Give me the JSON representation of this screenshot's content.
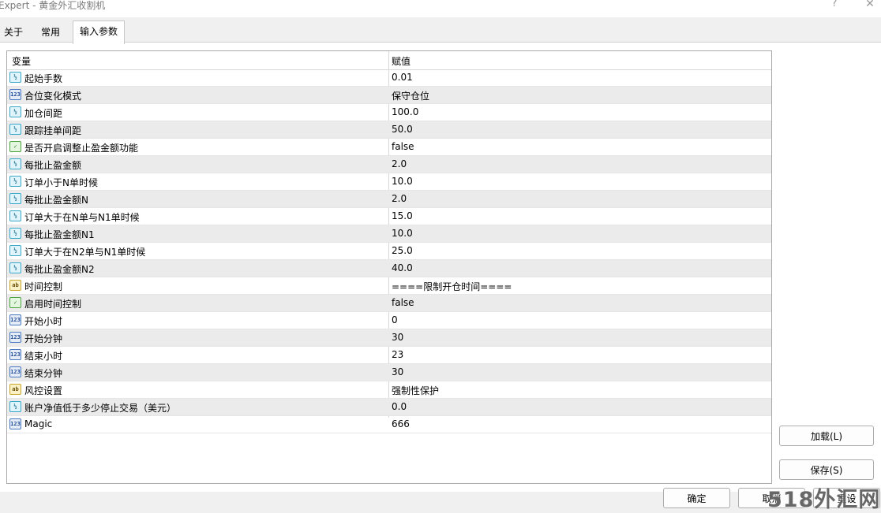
{
  "window": {
    "title": "Expert - 黄金外汇收割机",
    "help_glyph": "?",
    "close_glyph": "✕"
  },
  "tabs": [
    {
      "label": "关于"
    },
    {
      "label": "常用"
    },
    {
      "label": "输入参数",
      "selected": true
    }
  ],
  "table": {
    "headers": {
      "variable": "变量",
      "value": "赋值"
    },
    "rows": [
      {
        "icon": "double-type-icon",
        "tag": "½",
        "variable": "起始手数",
        "value": "0.01"
      },
      {
        "icon": "int-type-icon",
        "tag": "123",
        "variable": "合位变化模式",
        "value": "保守仓位"
      },
      {
        "icon": "double-type-icon",
        "tag": "½",
        "variable": "加仓间距",
        "value": "100.0"
      },
      {
        "icon": "double-type-icon",
        "tag": "½",
        "variable": "跟踪挂单间距",
        "value": "50.0"
      },
      {
        "icon": "bool-type-icon",
        "tag": "✓",
        "variable": "是否开启调整止盈金额功能",
        "value": "false"
      },
      {
        "icon": "double-type-icon",
        "tag": "½",
        "variable": "每批止盈金额",
        "value": "2.0"
      },
      {
        "icon": "double-type-icon",
        "tag": "½",
        "variable": "订单小于N单时候",
        "value": "10.0"
      },
      {
        "icon": "double-type-icon",
        "tag": "½",
        "variable": "每批止盈金额N",
        "value": "2.0"
      },
      {
        "icon": "double-type-icon",
        "tag": "½",
        "variable": "订单大于在N单与N1单时候",
        "value": "15.0"
      },
      {
        "icon": "double-type-icon",
        "tag": "½",
        "variable": "每批止盈金额N1",
        "value": "10.0"
      },
      {
        "icon": "double-type-icon",
        "tag": "½",
        "variable": "订单大于在N2单与N1单时候",
        "value": "25.0"
      },
      {
        "icon": "double-type-icon",
        "tag": "½",
        "variable": "每批止盈金额N2",
        "value": "40.0"
      },
      {
        "icon": "string-type-icon",
        "tag": "ab",
        "variable": "时间控制",
        "value": "====限制开仓时间===="
      },
      {
        "icon": "bool-type-icon",
        "tag": "✓",
        "variable": "启用时间控制",
        "value": "false"
      },
      {
        "icon": "int-type-icon",
        "tag": "123",
        "variable": "开始小时",
        "value": "0"
      },
      {
        "icon": "int-type-icon",
        "tag": "123",
        "variable": "开始分钟",
        "value": "30"
      },
      {
        "icon": "int-type-icon",
        "tag": "123",
        "variable": "结束小时",
        "value": "23"
      },
      {
        "icon": "int-type-icon",
        "tag": "123",
        "variable": "结束分钟",
        "value": "30"
      },
      {
        "icon": "string-type-icon",
        "tag": "ab",
        "variable": "风控设置",
        "value": "强制性保护"
      },
      {
        "icon": "double-type-icon",
        "tag": "½",
        "variable": "账户净值低于多少停止交易（美元）",
        "value": "0.0"
      },
      {
        "icon": "int-type-icon",
        "tag": "123",
        "variable": "Magic",
        "value": "666"
      }
    ]
  },
  "buttons": {
    "load": "加载(L)",
    "save": "保存(S)",
    "ok": "确定",
    "cancel": "取消",
    "reset": "重设"
  },
  "watermark": "518外汇网"
}
